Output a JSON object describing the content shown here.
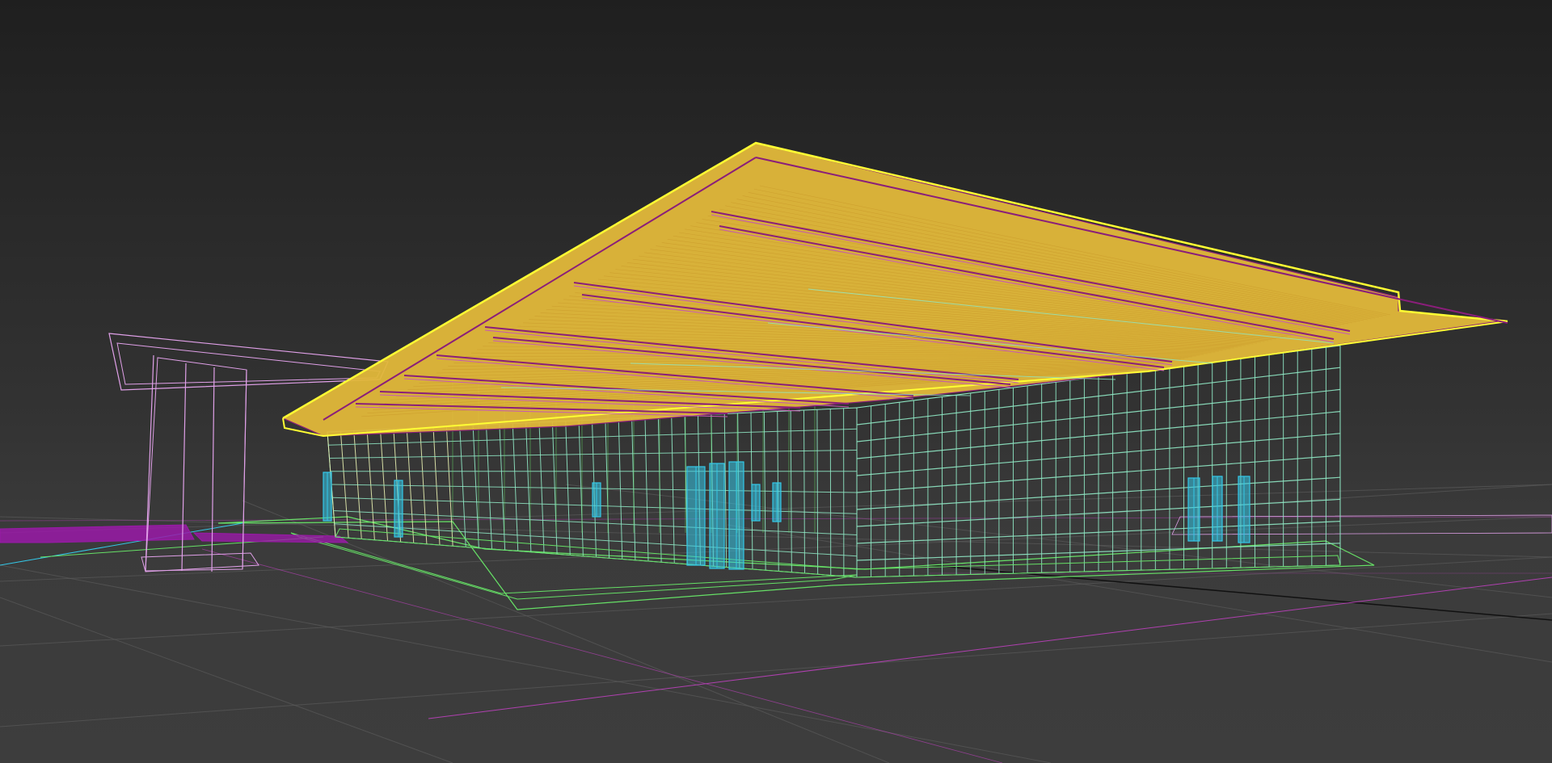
{
  "viewport": {
    "view": "perspective",
    "shading": "wireframe",
    "grid_visible": true
  },
  "colors": {
    "background_top": "#1f1f1f",
    "background_bottom": "#3d3d3d",
    "grid": "#5a5a5a",
    "canopy_outline": "#ffff33",
    "canopy_fill": "#e2b83a",
    "canopy_edges": "#8a1e7a",
    "beams": "#c85ab4",
    "curtain_wall": "#8fe8c4",
    "glass_light": "#e8f0b0",
    "doors": "#34c8e8",
    "site_lines": "#66e066",
    "pink_structure": "#e0a0e8",
    "purple_site": "#9a1aa8",
    "magenta_line": "#b040b0",
    "black_axis": "#111111"
  },
  "objects": [
    {
      "name": "roof-canopy",
      "color_key": "canopy_outline"
    },
    {
      "name": "roof-beams",
      "color_key": "beams"
    },
    {
      "name": "curtain-wall",
      "color_key": "curtain_wall"
    },
    {
      "name": "entrance-doors",
      "color_key": "doors"
    },
    {
      "name": "side-frame",
      "color_key": "pink_structure"
    },
    {
      "name": "site-boundary",
      "color_key": "site_lines"
    }
  ]
}
